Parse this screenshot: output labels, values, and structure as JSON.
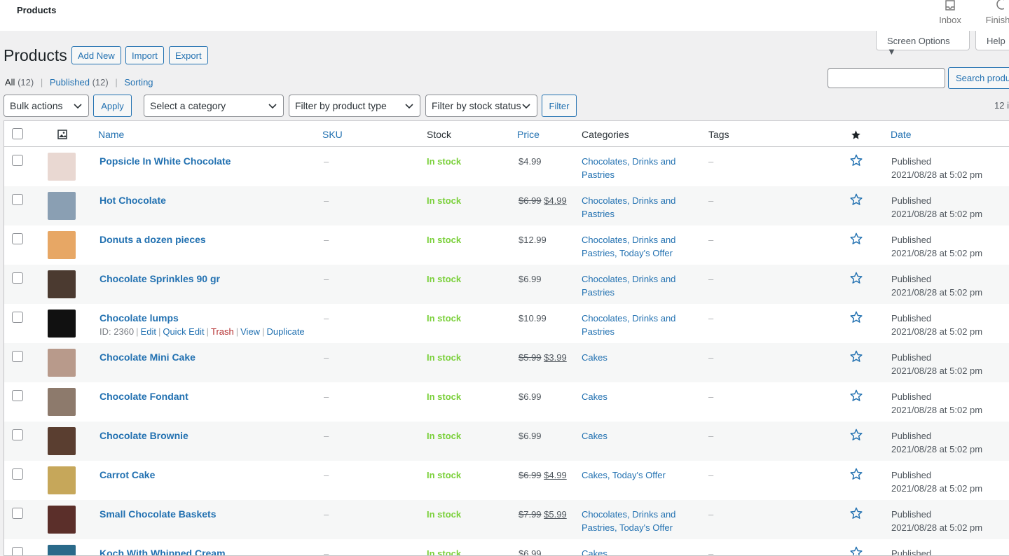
{
  "topbar": {
    "title": "Products",
    "inbox_label": "Inbox",
    "finish_label": "Finish"
  },
  "screen_options": {
    "label": "Screen Options ▼",
    "help": "Help"
  },
  "header": {
    "title": "Products",
    "add_new": "Add New",
    "import": "Import",
    "export": "Export"
  },
  "views": {
    "all": "All",
    "all_count": "(12)",
    "published": "Published",
    "published_count": "(12)",
    "sorting": "Sorting",
    "sep": "|"
  },
  "search": {
    "button": "Search produ"
  },
  "filters": {
    "bulk_actions": "Bulk actions",
    "apply": "Apply",
    "category": "Select a category",
    "product_type": "Filter by product type",
    "stock_status": "Filter by stock status",
    "filter": "Filter",
    "count": "12 i"
  },
  "columns": {
    "name": "Name",
    "sku": "SKU",
    "stock": "Stock",
    "price": "Price",
    "categories": "Categories",
    "tags": "Tags",
    "date": "Date"
  },
  "row_actions": {
    "id": "ID: 2360",
    "edit": "Edit",
    "quick_edit": "Quick Edit",
    "trash": "Trash",
    "view": "View",
    "duplicate": "Duplicate"
  },
  "products": [
    {
      "name": "Popsicle In White Chocolate",
      "sku": "–",
      "stock": "In stock",
      "price_old": "",
      "price": "$4.99",
      "categories": "Chocolates, Drinks and Pastries",
      "tags": "–",
      "status": "Published",
      "date": "2021/08/28 at 5:02 pm",
      "thumb_color": "#e9d8d2"
    },
    {
      "name": "Hot Chocolate",
      "sku": "–",
      "stock": "In stock",
      "price_old": "$6.99",
      "price": "$4.99",
      "categories": "Chocolates, Drinks and Pastries",
      "tags": "–",
      "status": "Published",
      "date": "2021/08/28 at 5:02 pm",
      "thumb_color": "#8a9fb3"
    },
    {
      "name": "Donuts a dozen pieces",
      "sku": "–",
      "stock": "In stock",
      "price_old": "",
      "price": "$12.99",
      "categories": "Chocolates, Drinks and Pastries, Today's Offer",
      "tags": "–",
      "status": "Published",
      "date": "2021/08/28 at 5:02 pm",
      "thumb_color": "#e7a765"
    },
    {
      "name": "Chocolate Sprinkles 90 gr",
      "sku": "–",
      "stock": "In stock",
      "price_old": "",
      "price": "$6.99",
      "categories": "Chocolates, Drinks and Pastries",
      "tags": "–",
      "status": "Published",
      "date": "2021/08/28 at 5:02 pm",
      "thumb_color": "#4b3a30"
    },
    {
      "name": "Chocolate lumps",
      "sku": "–",
      "stock": "In stock",
      "price_old": "",
      "price": "$10.99",
      "categories": "Chocolates, Drinks and Pastries",
      "tags": "–",
      "status": "Published",
      "date": "2021/08/28 at 5:02 pm",
      "thumb_color": "#111111"
    },
    {
      "name": "Chocolate Mini Cake",
      "sku": "–",
      "stock": "In stock",
      "price_old": "$5.99",
      "price": "$3.99",
      "categories": "Cakes",
      "tags": "–",
      "status": "Published",
      "date": "2021/08/28 at 5:02 pm",
      "thumb_color": "#b89a8b"
    },
    {
      "name": "Chocolate Fondant",
      "sku": "–",
      "stock": "In stock",
      "price_old": "",
      "price": "$6.99",
      "categories": "Cakes",
      "tags": "–",
      "status": "Published",
      "date": "2021/08/28 at 5:02 pm",
      "thumb_color": "#8d7a6c"
    },
    {
      "name": "Chocolate Brownie",
      "sku": "–",
      "stock": "In stock",
      "price_old": "",
      "price": "$6.99",
      "categories": "Cakes",
      "tags": "–",
      "status": "Published",
      "date": "2021/08/28 at 5:02 pm",
      "thumb_color": "#5a3e30"
    },
    {
      "name": "Carrot Cake",
      "sku": "–",
      "stock": "In stock",
      "price_old": "$6.99",
      "price": "$4.99",
      "categories": "Cakes, Today's Offer",
      "tags": "–",
      "status": "Published",
      "date": "2021/08/28 at 5:02 pm",
      "thumb_color": "#c6a75a"
    },
    {
      "name": "Small Chocolate Baskets",
      "sku": "–",
      "stock": "In stock",
      "price_old": "$7.99",
      "price": "$5.99",
      "categories": "Chocolates, Drinks and Pastries, Today's Offer",
      "tags": "–",
      "status": "Published",
      "date": "2021/08/28 at 5:02 pm",
      "thumb_color": "#5b2f2a"
    },
    {
      "name": "Koch With Whipped Cream",
      "sku": "–",
      "stock": "In stock",
      "price_old": "",
      "price": "$6.99",
      "categories": "Cakes",
      "tags": "–",
      "status": "Published",
      "date": "",
      "thumb_color": "#2a6a8a"
    }
  ],
  "colors": {
    "link": "#2271b1",
    "in_stock": "#7ad03a",
    "trash": "#b32d2e"
  }
}
